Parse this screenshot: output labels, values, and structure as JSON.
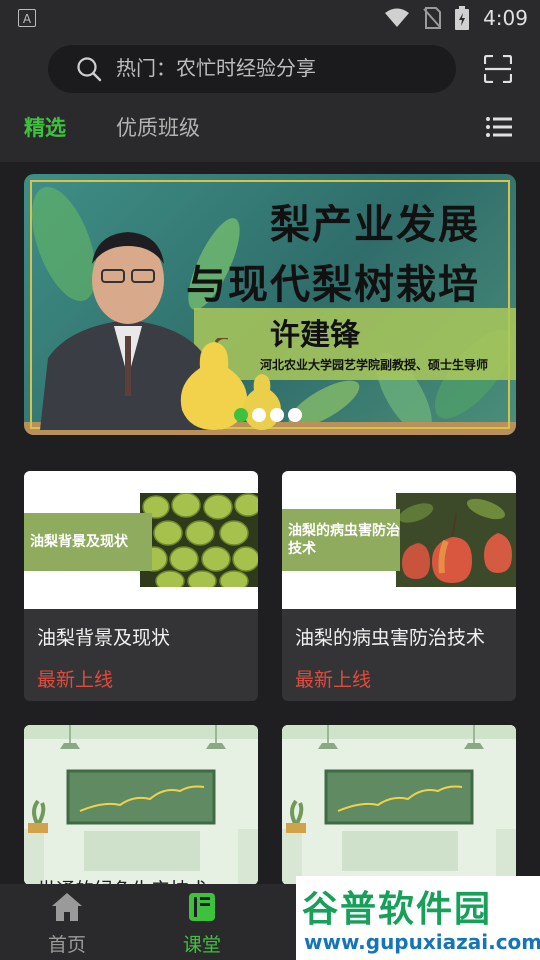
{
  "status_bar": {
    "time": "4:09"
  },
  "search": {
    "placeholder": "热门：农忙时经验分享"
  },
  "tabs": [
    {
      "label": "精选",
      "active": true
    },
    {
      "label": "优质班级",
      "active": false
    }
  ],
  "banner": {
    "title_line1": "梨产业发展",
    "title_line2": "与现代梨树栽培",
    "name": "许建锋",
    "subtitle": "河北农业大学园艺学院副教授、硕士生导师",
    "carousel_total": 4,
    "carousel_active_index": 0
  },
  "cards": [
    {
      "tag": "油梨背景及现状",
      "title": "油梨背景及现状",
      "status": "最新上线"
    },
    {
      "tag": "油梨的病虫害防治技术",
      "title": "油梨的病虫害防治技术",
      "status": "最新上线"
    },
    {
      "title": "世通的绿色生产技术"
    },
    {
      "title": ""
    }
  ],
  "bottom_nav": [
    {
      "label": "首页",
      "icon": "home-icon",
      "active": false
    },
    {
      "label": "课堂",
      "icon": "book-icon",
      "active": true
    }
  ],
  "watermark": {
    "title": "谷普软件园",
    "url": "www.gupuxiazai.com"
  },
  "colors": {
    "accent": "#3ec23d",
    "status_new": "#e04b3c",
    "background": "#1f1f21",
    "surface": "#2a2a2c"
  }
}
